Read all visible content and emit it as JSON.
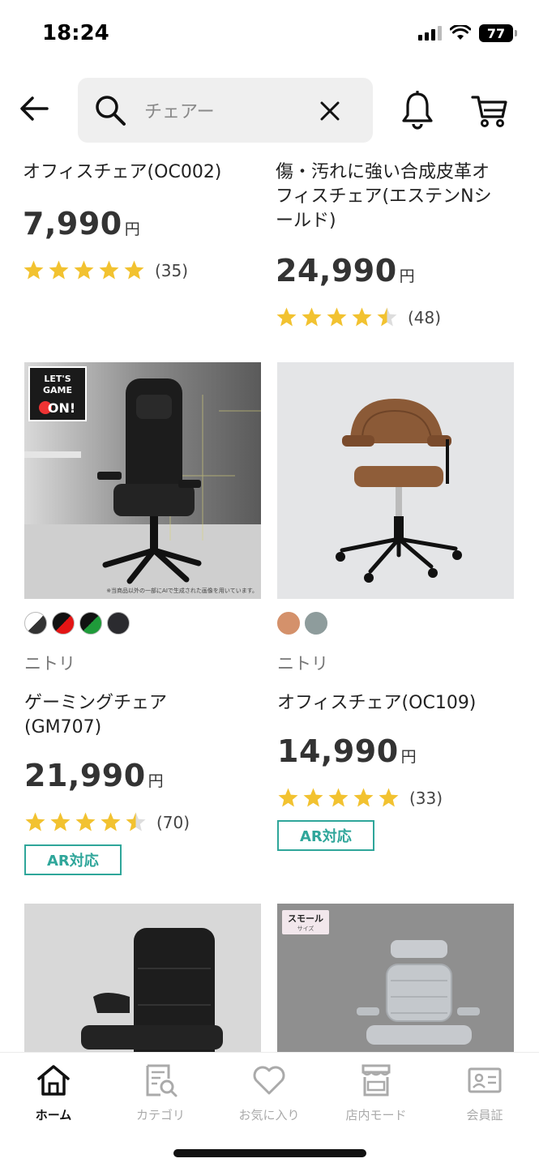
{
  "status_bar": {
    "time": "18:24",
    "battery": "77",
    "icons": [
      "cellular-signal-icon",
      "wifi-icon",
      "battery-icon"
    ]
  },
  "header": {
    "search_value": "チェアー",
    "icons": [
      "back-arrow-icon",
      "search-icon",
      "close-icon",
      "bell-icon",
      "cart-icon"
    ]
  },
  "products": [
    {
      "name": "オフィスチェア(OC002)",
      "price": "7,990",
      "currency": "円",
      "rating": 5,
      "review_count": "(35)"
    },
    {
      "name": "傷・汚れに強い合成皮革オフィスチェア(エステンNシールド)",
      "price": "24,990",
      "currency": "円",
      "rating": 4.5,
      "review_count": "(48)"
    },
    {
      "name": "ゲーミングチェア(GM707)",
      "brand": "ニトリ",
      "price": "21,990",
      "currency": "円",
      "rating": 4.5,
      "review_count": "(70)",
      "badge": "AR対応",
      "image_overlay_lines": [
        "LET'S",
        "GAME",
        "ON!"
      ],
      "image_note": "※当商品以外の一部にAIで生成された画像を用いています。",
      "swatches": [
        {
          "color": "#ffffff",
          "accent": "#333333"
        },
        {
          "color": "#e31414",
          "accent": "#111111"
        },
        {
          "color": "#1f9b3a",
          "accent": "#111111"
        },
        {
          "color": "#2b2b2f",
          "accent": "#2b2b2f"
        }
      ]
    },
    {
      "name": "オフィスチェア(OC109)",
      "brand": "ニトリ",
      "price": "14,990",
      "currency": "円",
      "rating": 5,
      "review_count": "(33)",
      "badge": "AR対応",
      "swatches": [
        {
          "color": "#d4916b",
          "accent": "#d4916b"
        },
        {
          "color": "#8e9c9c",
          "accent": "#8e9c9c"
        }
      ]
    },
    {
      "image_tag": null
    },
    {
      "image_tag": "スモール",
      "image_tag_sub": "サイズ"
    }
  ],
  "bottom_nav": [
    {
      "label": "ホーム",
      "icon": "home-icon",
      "active": true
    },
    {
      "label": "カテゴリ",
      "icon": "category-search-icon",
      "active": false
    },
    {
      "label": "お気に入り",
      "icon": "heart-icon",
      "active": false
    },
    {
      "label": "店内モード",
      "icon": "store-icon",
      "active": false
    },
    {
      "label": "会員証",
      "icon": "member-card-icon",
      "active": false
    }
  ],
  "colors": {
    "star": "#f2c230",
    "star_empty": "#dddddd",
    "accent": "#2fa69a",
    "search_bg": "#efefef"
  }
}
